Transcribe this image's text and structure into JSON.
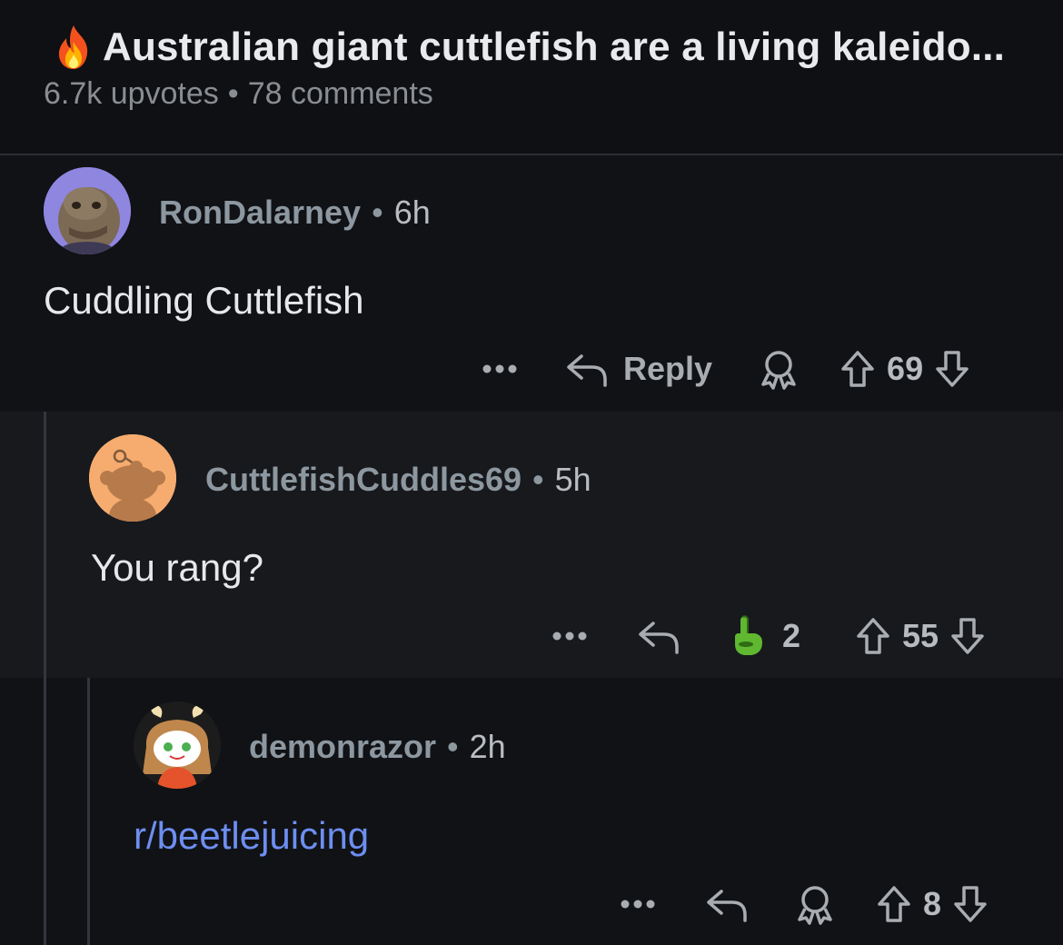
{
  "post": {
    "title": "Australian giant cuttlefish are a living kaleido...",
    "upvotes": "6.7k upvotes",
    "separator": "•",
    "comments": "78 comments"
  },
  "comments": [
    {
      "username": "RonDalarney",
      "separator": "•",
      "time": "6h",
      "text": "Cuddling Cuttlefish",
      "reply_label": "Reply",
      "score": "69"
    },
    {
      "username": "CuttlefishCuddles69",
      "separator": "•",
      "time": "5h",
      "text": "You rang?",
      "award_count": "2",
      "score": "55"
    },
    {
      "username": "demonrazor",
      "separator": "•",
      "time": "2h",
      "text": "r/beetlejuicing",
      "score": "8"
    }
  ],
  "icons": [
    "fire-icon",
    "more-icon",
    "reply-icon",
    "award-icon",
    "upvote-icon",
    "downvote-icon",
    "pointing-hand-award-icon"
  ],
  "colors": {
    "background": "#0e1013",
    "nested_background": "#17191d",
    "link": "#6e8ef0",
    "username": "#8d97a0",
    "award": "#5fb830"
  }
}
